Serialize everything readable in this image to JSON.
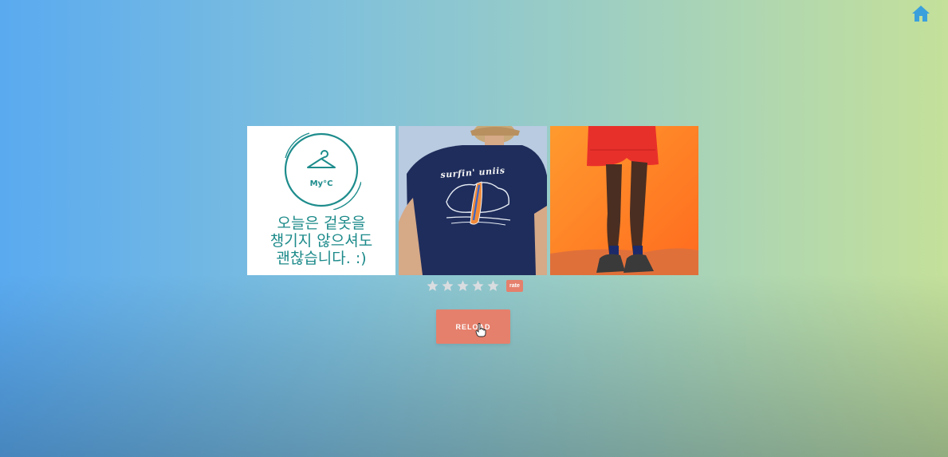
{
  "header": {
    "home_icon": "home-icon",
    "accent_color": "#3aa0dc"
  },
  "gallery": {
    "logo_card": {
      "icon": "hanger-icon",
      "brand": "My°C",
      "message_lines": [
        "오늘은 겉옷을",
        "챙기지 않으셔도",
        "괜찮습니다. :)"
      ]
    },
    "photo_top": {
      "caption": "surfin' uniis"
    },
    "photo_bottom": {}
  },
  "rating": {
    "stars": 5,
    "star_color": "#d9dde0",
    "rate_label": "rate"
  },
  "reload": {
    "label": "RELOAD",
    "color": "#e5806c"
  }
}
